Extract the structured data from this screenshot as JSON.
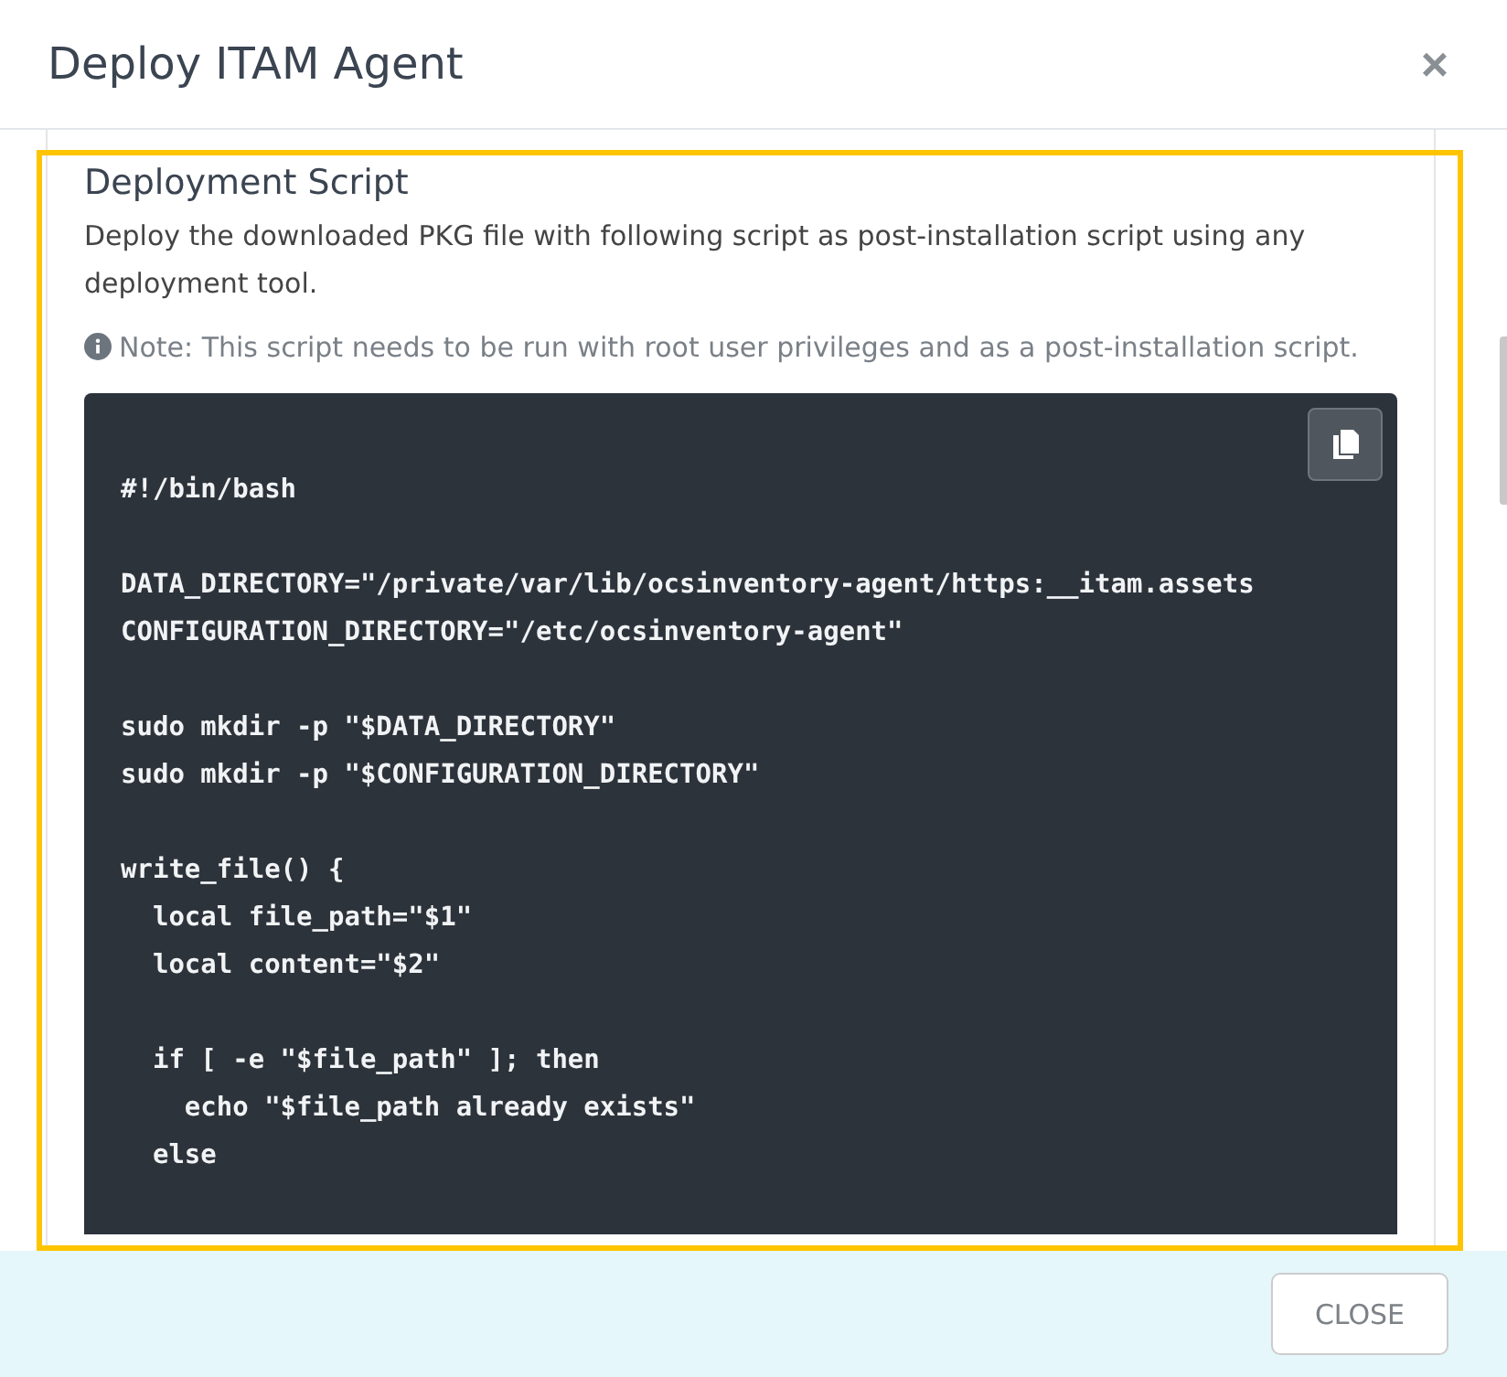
{
  "modal": {
    "title": "Deploy ITAM Agent",
    "close_icon": "×"
  },
  "section": {
    "heading": "Deployment Script",
    "description": "Deploy the downloaded PKG file with following script as post-installation script using any deployment tool.",
    "note": "Note: This script needs to be run with root user privileges and as a post-installation script."
  },
  "code_blocks": [
    {
      "lines": [
        "#!/bin/bash"
      ]
    },
    {
      "lines": [
        "DATA_DIRECTORY=\"/private/var/lib/ocsinventory-agent/https:__itam.assets",
        "CONFIGURATION_DIRECTORY=\"/etc/ocsinventory-agent\""
      ]
    },
    {
      "lines": [
        "sudo mkdir -p \"$DATA_DIRECTORY\"",
        "sudo mkdir -p \"$CONFIGURATION_DIRECTORY\""
      ]
    },
    {
      "lines": [
        "write_file() {",
        "  local file_path=\"$1\"",
        "  local content=\"$2\""
      ]
    },
    {
      "lines": [
        "  if [ -e \"$file_path\" ]; then",
        "    echo \"$file_path already exists\"",
        "  else"
      ]
    }
  ],
  "footer": {
    "buttons": [
      "CLOSE"
    ]
  }
}
